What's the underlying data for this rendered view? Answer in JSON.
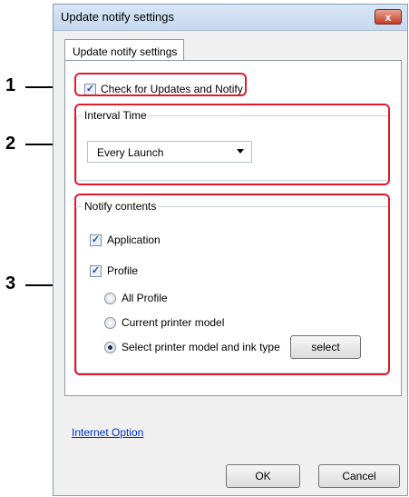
{
  "window": {
    "title": "Update notify settings",
    "close_symbol": "x",
    "tab_label": "Update notify settings"
  },
  "check_updates": {
    "label": "Check for Updates and Notify",
    "checked": true
  },
  "interval": {
    "group_title": "Interval Time",
    "selected": "Every Launch"
  },
  "notify": {
    "group_title": "Notify contents",
    "application": {
      "label": "Application",
      "checked": true
    },
    "profile": {
      "label": "Profile",
      "checked": true
    },
    "radios": [
      {
        "label": "All Profile",
        "selected": false
      },
      {
        "label": "Current printer model",
        "selected": false
      },
      {
        "label": "Select printer model and ink type",
        "selected": true
      }
    ],
    "select_button": "select"
  },
  "footer": {
    "internet_option": "Internet Option",
    "ok": "OK",
    "cancel": "Cancel"
  },
  "callouts": [
    "1",
    "2",
    "3"
  ],
  "colors": {
    "callout_border": "#e3192d",
    "link": "#0033cc"
  }
}
